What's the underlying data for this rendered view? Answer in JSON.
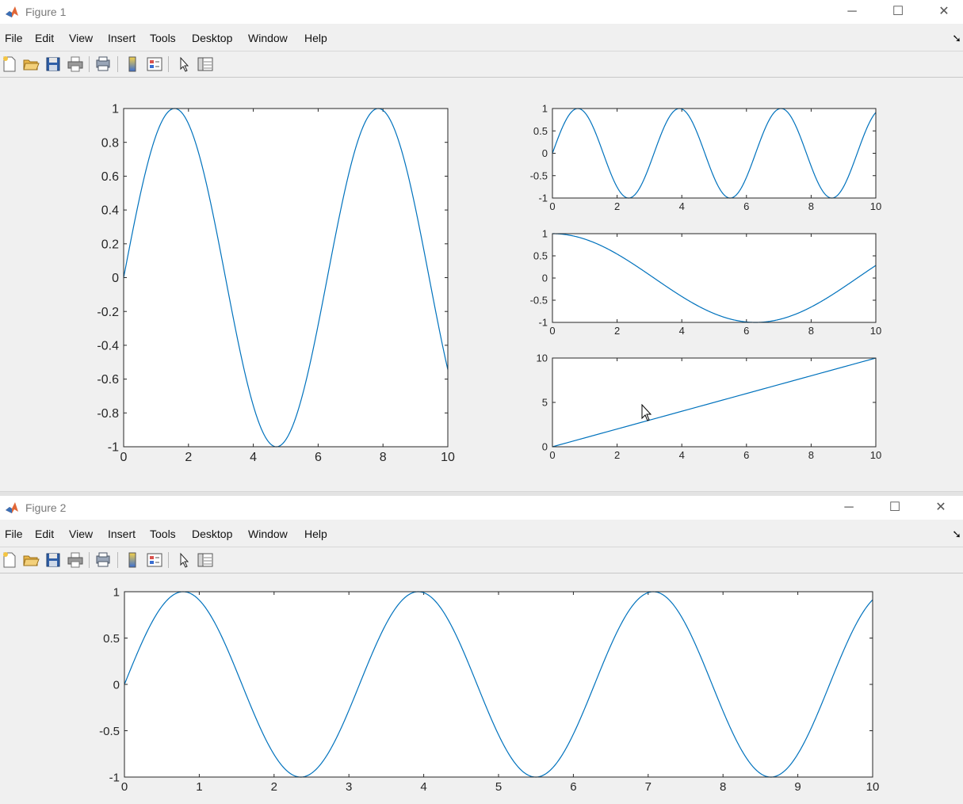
{
  "windows": [
    {
      "title": "Figure 1",
      "menu": [
        "File",
        "Edit",
        "View",
        "Insert",
        "Tools",
        "Desktop",
        "Window",
        "Help"
      ]
    },
    {
      "title": "Figure 2",
      "menu": [
        "File",
        "Edit",
        "View",
        "Insert",
        "Tools",
        "Desktop",
        "Window",
        "Help"
      ]
    }
  ],
  "window_controls": {
    "minimize": "─",
    "maximize": "☐",
    "close": "✕"
  },
  "toolbar_icons": [
    "new-figure-icon",
    "open-file-icon",
    "save-icon",
    "print-icon",
    "print-preview-icon",
    "colorbar-icon",
    "legend-icon",
    "pointer-icon",
    "property-editor-icon"
  ],
  "colors": {
    "line": "#0072bd",
    "axes": "#262626"
  },
  "chart_data": [
    {
      "type": "line",
      "figure": "Figure 1",
      "function": "sin(x)",
      "x_range": [
        0,
        10
      ],
      "xlim": [
        0,
        10
      ],
      "ylim": [
        -1,
        1
      ],
      "xticks": [
        "0",
        "2",
        "4",
        "6",
        "8",
        "10"
      ],
      "yticks": [
        "-1",
        "-0.8",
        "-0.6",
        "-0.4",
        "-0.2",
        "0",
        "0.2",
        "0.4",
        "0.6",
        "0.8",
        "1"
      ]
    },
    {
      "type": "line",
      "figure": "Figure 1",
      "function": "sin(2x)",
      "x_range": [
        0,
        10
      ],
      "xlim": [
        0,
        10
      ],
      "ylim": [
        -1,
        1
      ],
      "xticks": [
        "0",
        "2",
        "4",
        "6",
        "8",
        "10"
      ],
      "yticks": [
        "-1",
        "-0.5",
        "0",
        "0.5",
        "1"
      ]
    },
    {
      "type": "line",
      "figure": "Figure 1",
      "function": "cos(x/2)",
      "x_range": [
        0,
        10
      ],
      "xlim": [
        0,
        10
      ],
      "ylim": [
        -1,
        1
      ],
      "xticks": [
        "0",
        "2",
        "4",
        "6",
        "8",
        "10"
      ],
      "yticks": [
        "-1",
        "-0.5",
        "0",
        "0.5",
        "1"
      ]
    },
    {
      "type": "line",
      "figure": "Figure 1",
      "function": "x",
      "x_range": [
        0,
        10
      ],
      "xlim": [
        0,
        10
      ],
      "ylim": [
        0,
        10
      ],
      "xticks": [
        "0",
        "2",
        "4",
        "6",
        "8",
        "10"
      ],
      "yticks": [
        "0",
        "5",
        "10"
      ]
    },
    {
      "type": "line",
      "figure": "Figure 2",
      "function": "sin(2x)",
      "x_range": [
        0,
        10
      ],
      "xlim": [
        0,
        10
      ],
      "ylim": [
        -1,
        1
      ],
      "xticks": [
        "0",
        "1",
        "2",
        "3",
        "4",
        "5",
        "6",
        "7",
        "8",
        "9",
        "10"
      ],
      "yticks": [
        "-1",
        "-0.5",
        "0",
        "0.5",
        "1"
      ]
    }
  ]
}
